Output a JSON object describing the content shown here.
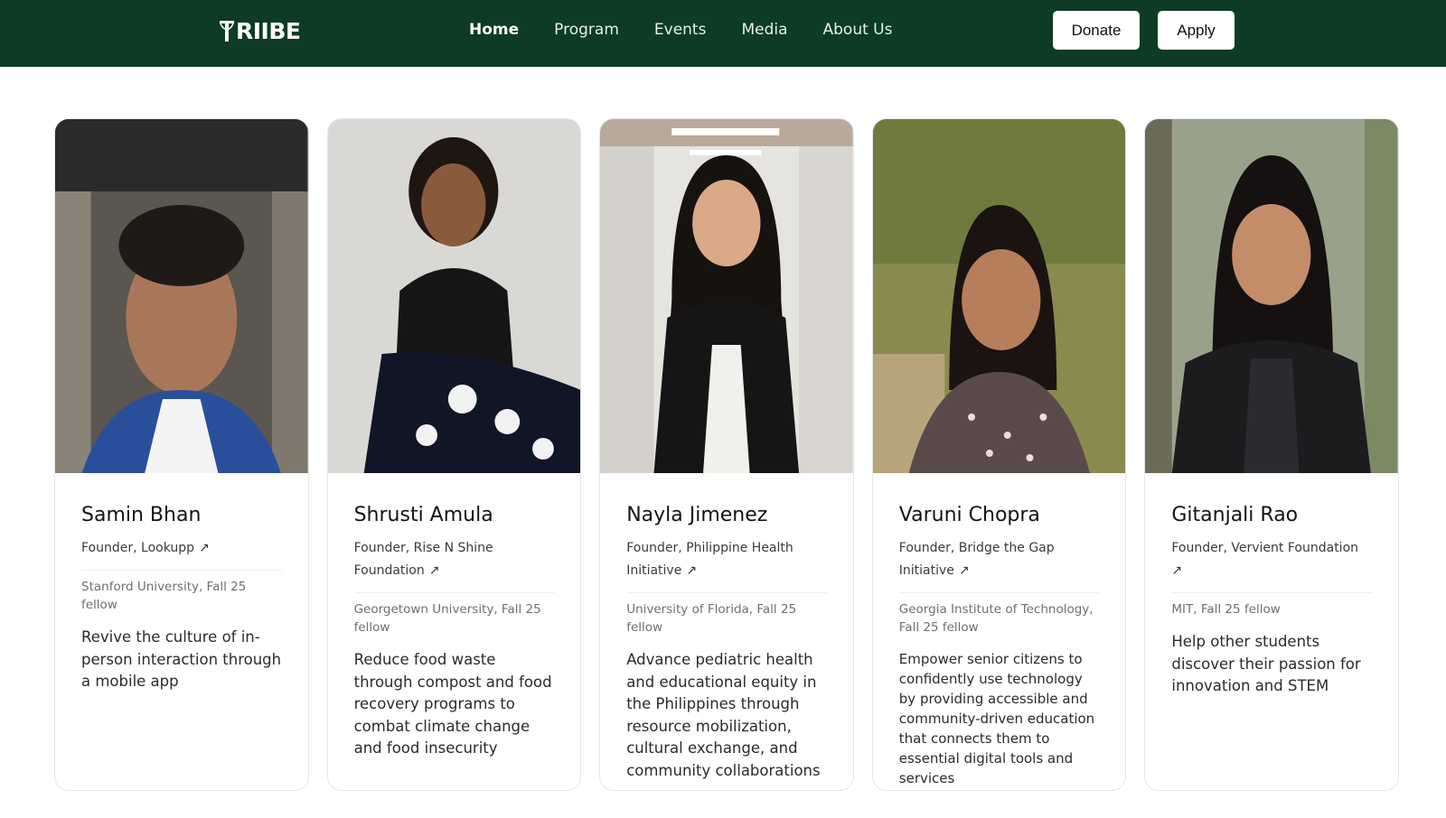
{
  "header": {
    "logo_text": "RIIBE",
    "nav": [
      {
        "label": "Home",
        "active": true
      },
      {
        "label": "Program",
        "active": false
      },
      {
        "label": "Events",
        "active": false
      },
      {
        "label": "Media",
        "active": false
      },
      {
        "label": "About Us",
        "active": false
      }
    ],
    "donate_label": "Donate",
    "apply_label": "Apply"
  },
  "fellows": [
    {
      "name": "Samin Bhan",
      "role": "Founder, Lookupp",
      "school": "Stanford University, Fall 25 fellow",
      "description": "Revive the culture of in-person interaction through a mobile app"
    },
    {
      "name": "Shrusti Amula",
      "role": "Founder, Rise N Shine Foundation",
      "school": "Georgetown University, Fall 25 fellow",
      "description": "Reduce food waste through compost and food recovery programs to combat climate change and food insecurity"
    },
    {
      "name": "Nayla Jimenez",
      "role": "Founder, Philippine Health Initiative",
      "school": "University of Florida, Fall 25 fellow",
      "description": "Advance pediatric health and educational equity in the Philippines through resource mobilization, cultural exchange, and community collaborations"
    },
    {
      "name": "Varuni Chopra",
      "role": "Founder, Bridge the Gap Initiative",
      "school": "Georgia Institute of Technology, Fall 25 fellow",
      "description": "Empower senior citizens to confidently use technology by providing accessible and community-driven education that connects them to essential digital tools and services"
    },
    {
      "name": "Gitanjali Rao",
      "role": "Founder, Vervient Foundation",
      "school": "MIT, Fall 25 fellow",
      "description": "Help other students discover their passion for innovation and STEM"
    }
  ],
  "icons": {
    "external_link": "arrow-up-right-icon"
  },
  "colors": {
    "header_bg": "#0d3b24",
    "button_bg": "#ffffff"
  }
}
